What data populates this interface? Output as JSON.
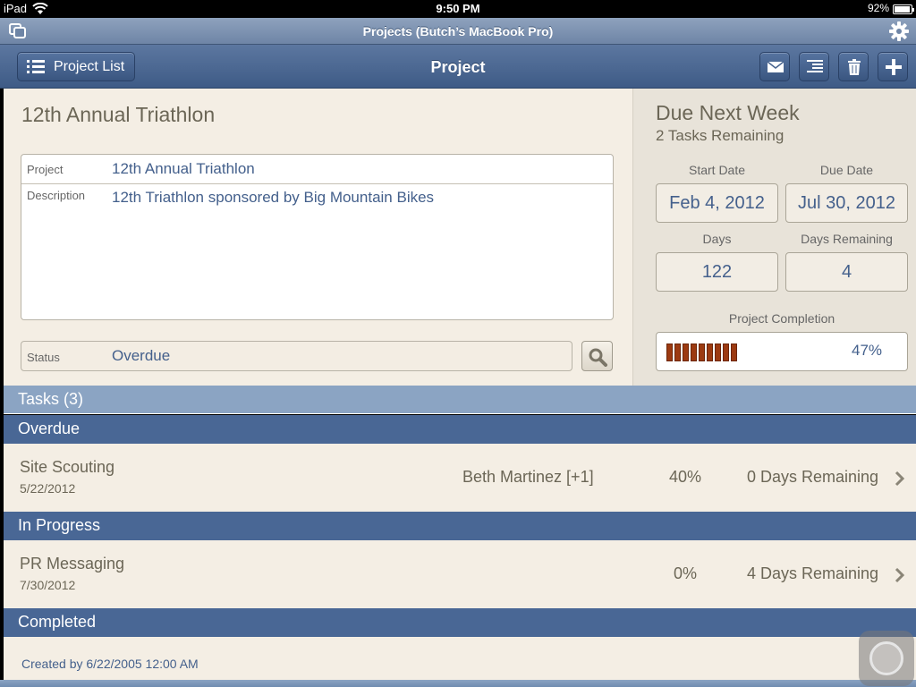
{
  "status_bar": {
    "device": "iPad",
    "time": "9:50 PM",
    "battery": "92%"
  },
  "window": {
    "title": "Projects (Butch’s MacBook Pro)"
  },
  "toolbar": {
    "project_list_label": "Project List",
    "title": "Project",
    "icons": [
      "mail-icon",
      "outline-icon",
      "trash-icon",
      "plus-icon"
    ]
  },
  "project": {
    "title": "12th Annual Triathlon",
    "fields": {
      "project_label": "Project",
      "project_value": "12th Annual Triathlon",
      "description_label": "Description",
      "description_value": "12th Triathlon sponsored by Big Mountain Bikes",
      "status_label": "Status",
      "status_value": "Overdue"
    }
  },
  "summary": {
    "due_heading": "Due Next Week",
    "tasks_remaining": "2 Tasks Remaining",
    "start_date_label": "Start Date",
    "start_date": "Feb 4, 2012",
    "due_date_label": "Due Date",
    "due_date": "Jul 30, 2012",
    "days_label": "Days",
    "days": "122",
    "days_remaining_label": "Days Remaining",
    "days_remaining": "4",
    "completion_label": "Project Completion",
    "completion_text": "47%",
    "completion_fraction": 0.47,
    "bar_color": "#9c3a11"
  },
  "tasks": {
    "header": "Tasks (3)",
    "sections": [
      {
        "label": "Overdue",
        "rows": [
          {
            "name": "Site Scouting",
            "date": "5/22/2012",
            "assignee": "Beth Martinez [+1]",
            "percent": "40%",
            "days": "0 Days Remaining"
          }
        ]
      },
      {
        "label": "In Progress",
        "rows": [
          {
            "name": "PR Messaging",
            "date": "7/30/2012",
            "assignee": "",
            "percent": "0%",
            "days": "4 Days Remaining"
          }
        ]
      },
      {
        "label": "Completed",
        "rows": []
      }
    ]
  },
  "footer": {
    "created": "Created by  6/22/2005 12:00 AM"
  }
}
